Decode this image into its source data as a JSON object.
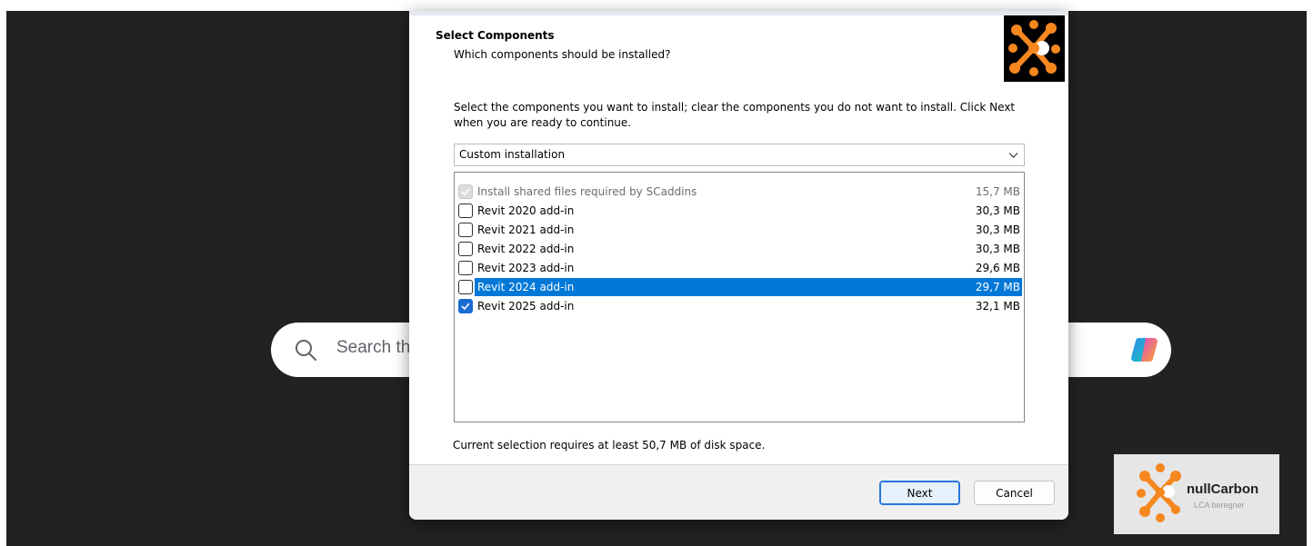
{
  "search": {
    "text": "Search th"
  },
  "dialog": {
    "title": "Select Components",
    "subtitle": "Which components should be installed?",
    "instruction": "Select the components you want to install; clear the components you do not want to install. Click Next when you are ready to continue.",
    "install_type": "Custom installation",
    "components": [
      {
        "name": "Install shared files required by SCaddins",
        "size": "15,7 MB",
        "checked": true,
        "disabled": true,
        "selected": false
      },
      {
        "name": "Revit 2020 add-in",
        "size": "30,3 MB",
        "checked": false,
        "disabled": false,
        "selected": false
      },
      {
        "name": "Revit 2021 add-in",
        "size": "30,3 MB",
        "checked": false,
        "disabled": false,
        "selected": false
      },
      {
        "name": "Revit 2022 add-in",
        "size": "30,3 MB",
        "checked": false,
        "disabled": false,
        "selected": false
      },
      {
        "name": "Revit 2023 add-in",
        "size": "29,6 MB",
        "checked": false,
        "disabled": false,
        "selected": false
      },
      {
        "name": "Revit 2024 add-in",
        "size": "29,7 MB",
        "checked": false,
        "disabled": false,
        "selected": true
      },
      {
        "name": "Revit 2025 add-in",
        "size": "32,1 MB",
        "checked": true,
        "disabled": false,
        "selected": false
      }
    ],
    "disk_space": "Current selection requires at least 50,7 MB of disk space.",
    "buttons": {
      "next": "Next",
      "cancel": "Cancel"
    }
  },
  "badge": {
    "title": "nullCarbon",
    "subtitle": "LCA beregner"
  },
  "colors": {
    "desktop": "#222222",
    "selection": "#0078d7",
    "checkbox_checked": "#1a6cd1",
    "brand_orange": "#f5871f"
  }
}
